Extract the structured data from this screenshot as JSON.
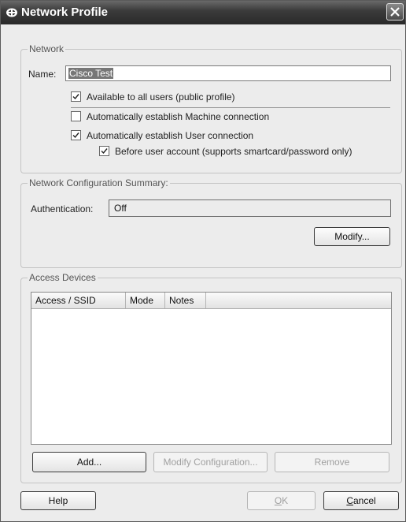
{
  "window": {
    "title": "Network Profile"
  },
  "network": {
    "legend": "Network",
    "name_label": "Name:",
    "name_value": "Cisco Test",
    "checkboxes": [
      {
        "label": "Available to all users (public profile)",
        "checked": true
      },
      {
        "label": "Automatically establish Machine connection",
        "checked": false
      },
      {
        "label": "Automatically establish User connection",
        "checked": true
      },
      {
        "label": "Before user account (supports smartcard/password only)",
        "checked": true
      }
    ]
  },
  "summary": {
    "legend": "Network Configuration Summary:",
    "auth_label": "Authentication:",
    "auth_value": "Off",
    "modify_button": "Modify..."
  },
  "access_devices": {
    "legend": "Access Devices",
    "columns": [
      "Access / SSID",
      "Mode",
      "Notes"
    ],
    "rows": [],
    "add_button": "Add...",
    "modify_config_button": "Modify Configuration...",
    "remove_button": "Remove"
  },
  "footer": {
    "help_button": "Help",
    "ok_button_prefix": "",
    "ok_button_mnemonic": "O",
    "ok_button_rest": "K",
    "cancel_button_mnemonic": "C",
    "cancel_button_rest": "ancel"
  },
  "colors": {
    "titlebar": "#3c3c3c",
    "window_bg": "#ececec"
  }
}
